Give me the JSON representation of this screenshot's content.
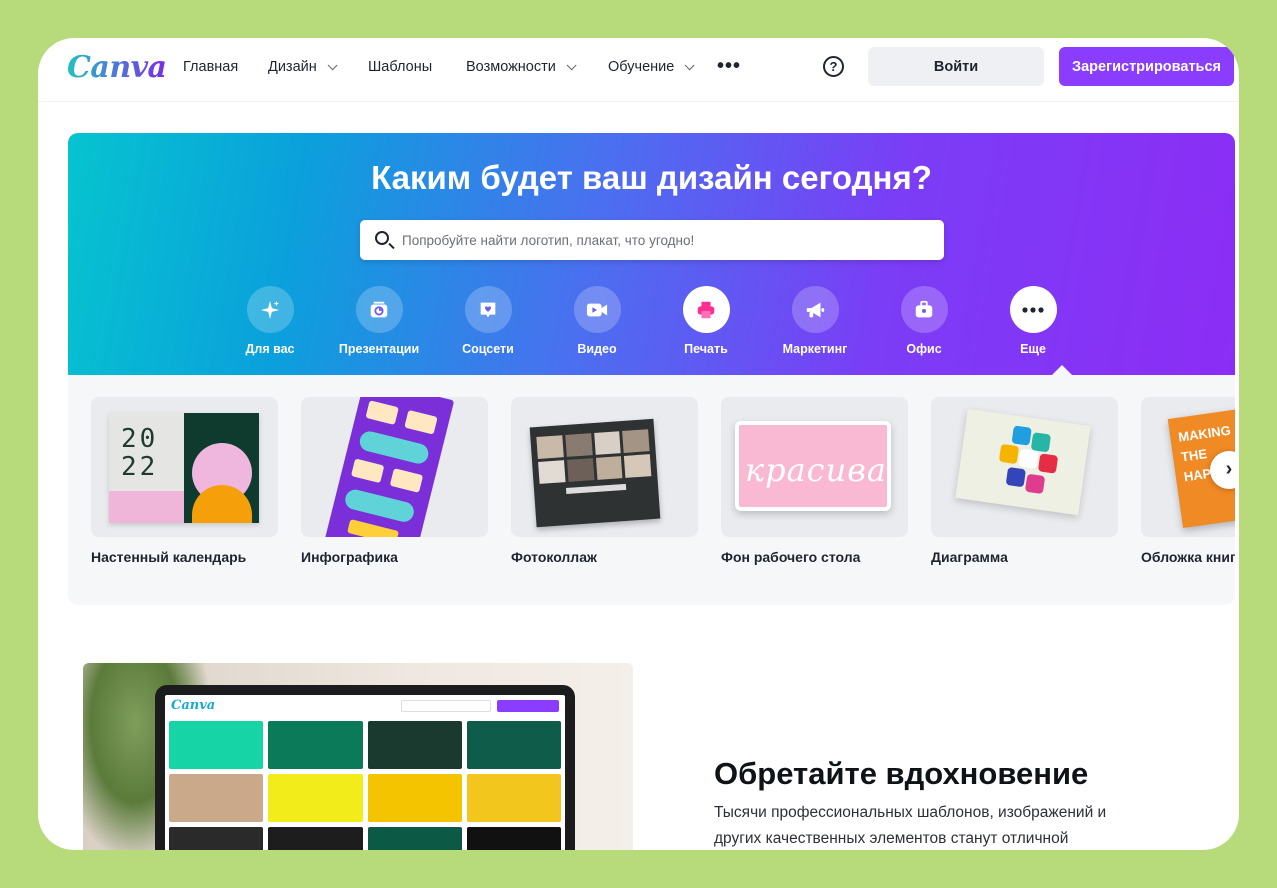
{
  "header": {
    "logo": "Canva",
    "nav": [
      {
        "label": "Главная",
        "dropdown": false
      },
      {
        "label": "Дизайн",
        "dropdown": true
      },
      {
        "label": "Шаблоны",
        "dropdown": false
      },
      {
        "label": "Возможности",
        "dropdown": true
      },
      {
        "label": "Обучение",
        "dropdown": true
      }
    ],
    "more_icon": "more-horizontal-icon",
    "help_icon": "help-circle-icon",
    "help_glyph": "?",
    "login_label": "Войти",
    "signup_label": "Зарегистрироваться"
  },
  "hero": {
    "title": "Каким будет ваш дизайн сегодня?",
    "search_placeholder": "Попробуйте найти логотип, плакат, что угодно!",
    "categories": [
      {
        "label": "Для вас",
        "icon": "sparkle-icon"
      },
      {
        "label": "Презентации",
        "icon": "presentation-icon"
      },
      {
        "label": "Соцсети",
        "icon": "heart-chat-icon"
      },
      {
        "label": "Видео",
        "icon": "video-camera-icon"
      },
      {
        "label": "Печать",
        "icon": "printer-icon"
      },
      {
        "label": "Маркетинг",
        "icon": "megaphone-icon"
      },
      {
        "label": "Офис",
        "icon": "briefcase-icon"
      },
      {
        "label": "Еще",
        "icon": "more-dots-icon"
      }
    ]
  },
  "templates": [
    {
      "label": "Настенный календарь"
    },
    {
      "label": "Инфографика"
    },
    {
      "label": "Фотоколлаж"
    },
    {
      "label": "Фон рабочего стола"
    },
    {
      "label": "Диаграмма"
    },
    {
      "label": "Обложка книги"
    }
  ],
  "thumb_text": {
    "calendar_top": "20",
    "calendar_bottom": "22",
    "desktop_script": "красива",
    "book": "MAKING THE HAPPY"
  },
  "inspire": {
    "title": "Обретайте вдохновение",
    "text": "Тысячи профессиональных шаблонов, изображений и других качественных элементов станут отличной"
  },
  "colors": {
    "brand_purple": "#8b3dff",
    "hero_start": "#06c4cf",
    "hero_end": "#8c2df5"
  }
}
